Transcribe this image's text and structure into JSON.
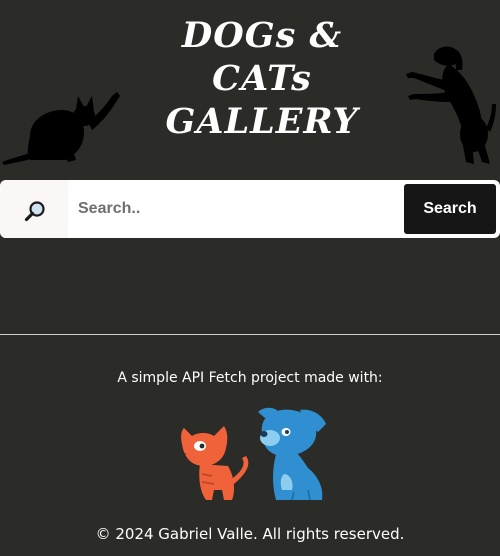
{
  "header": {
    "title_line1": "DOGs &",
    "title_line2": "CATs",
    "title_line3": "GALLERY"
  },
  "search": {
    "placeholder": "Search..",
    "value": "",
    "button_label": "Search",
    "icon": "magnifier-icon"
  },
  "footer": {
    "tagline": "A simple API Fetch project made with:",
    "illustration": "cat-and-dog-icon",
    "copyright": "© 2024 Gabriel Valle. All rights reserved."
  },
  "colors": {
    "background": "#2b2b27",
    "search_button": "#161616",
    "cat_orange": "#f0623a",
    "dog_blue": "#2f8fd0"
  }
}
